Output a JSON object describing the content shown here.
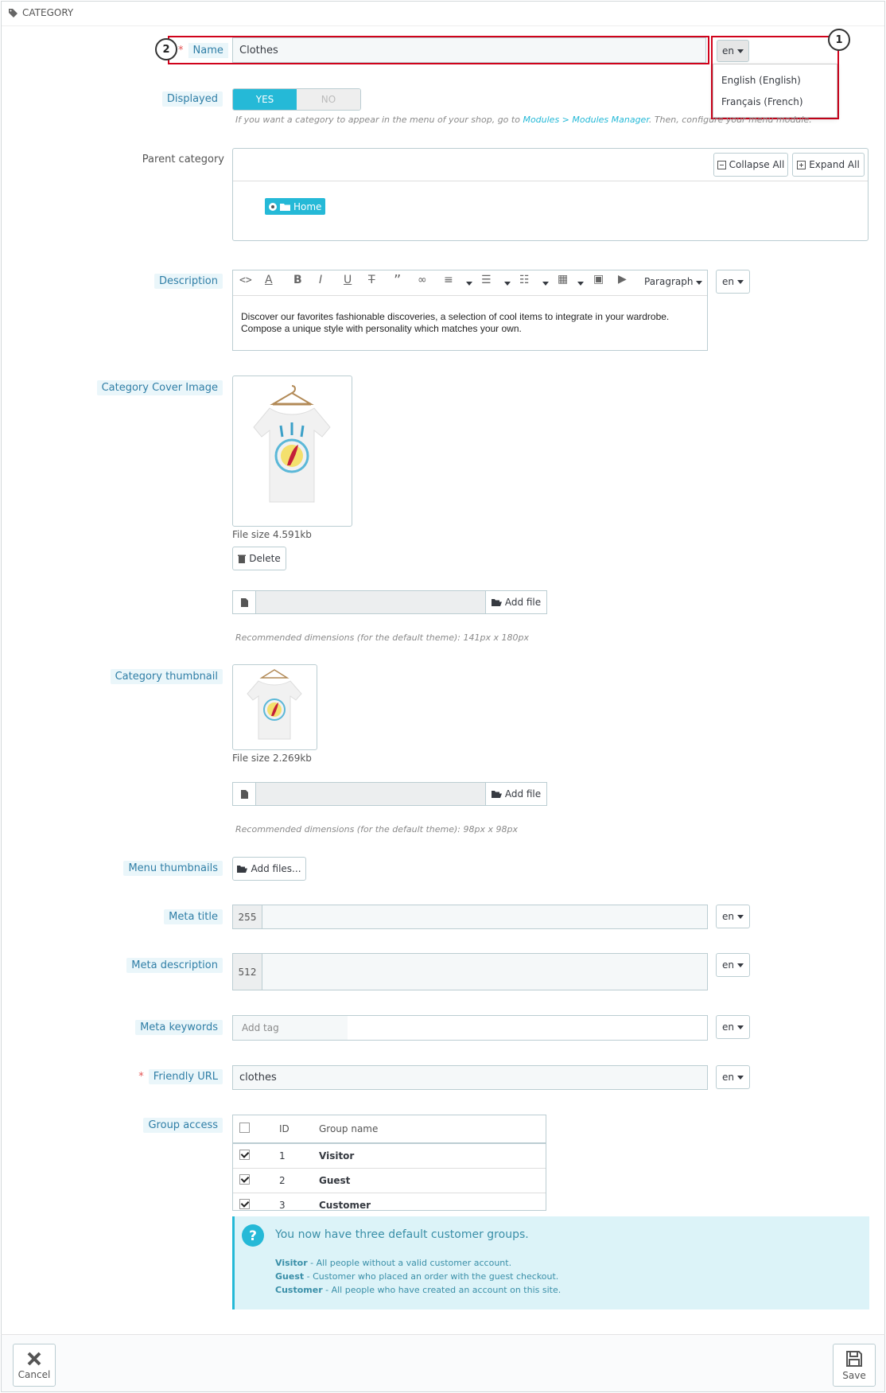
{
  "panel": {
    "heading": "CATEGORY",
    "heading_icon": "tags-icon"
  },
  "annotations": {
    "callout_1": "1",
    "callout_2": "2"
  },
  "name_field": {
    "required_mark": "*",
    "label": "Name",
    "value": "Clothes",
    "lang": "en"
  },
  "lang_dropdown": {
    "options": [
      "English (English)",
      "Français (French)"
    ]
  },
  "displayed": {
    "label": "Displayed",
    "yes": "YES",
    "no": "NO",
    "selected": "YES",
    "help_prefix": "If you want a category to appear in the menu of your shop, go to ",
    "help_link": "Modules > Modules Manager",
    "help_suffix": ". Then, configure your menu module."
  },
  "parent_category": {
    "label": "Parent category",
    "collapse_all": "Collapse All",
    "expand_all": "Expand All",
    "tree_root": "Home"
  },
  "description": {
    "label": "Description",
    "format": "Paragraph",
    "lang": "en",
    "text": "Discover our favorites fashionable discoveries, a selection of cool items to integrate in your wardrobe. Compose a unique style with personality which matches your own."
  },
  "cover_image": {
    "label": "Category Cover Image",
    "file_size": "File size 4.591kb",
    "delete": "Delete",
    "add_file": "Add file",
    "help": "Recommended dimensions (for the default theme): 141px x 180px"
  },
  "thumbnail": {
    "label": "Category thumbnail",
    "file_size": "File size 2.269kb",
    "add_file": "Add file",
    "help": "Recommended dimensions (for the default theme): 98px x 98px"
  },
  "menu_thumbnails": {
    "label": "Menu thumbnails",
    "add_files": "Add files..."
  },
  "meta_title": {
    "label": "Meta title",
    "counter": "255",
    "value": "",
    "lang": "en"
  },
  "meta_description": {
    "label": "Meta description",
    "counter": "512",
    "value": "",
    "lang": "en"
  },
  "meta_keywords": {
    "label": "Meta keywords",
    "placeholder": "Add tag",
    "lang": "en"
  },
  "friendly_url": {
    "required_mark": "*",
    "label": "Friendly URL",
    "value": "clothes",
    "lang": "en"
  },
  "group_access": {
    "label": "Group access",
    "columns": [
      "ID",
      "Group name"
    ],
    "rows": [
      {
        "id": "1",
        "name": "Visitor",
        "checked": true
      },
      {
        "id": "2",
        "name": "Guest",
        "checked": true
      },
      {
        "id": "3",
        "name": "Customer",
        "checked": true
      }
    ],
    "info_title": "You now have three default customer groups.",
    "info_lines": [
      {
        "term": "Visitor",
        "text": " - All people without a valid customer account."
      },
      {
        "term": "Guest",
        "text": " - Customer who placed an order with the guest checkout."
      },
      {
        "term": "Customer",
        "text": " - All people who have created an account on this site."
      }
    ]
  },
  "footer": {
    "cancel": "Cancel",
    "save": "Save"
  },
  "colors": {
    "accent": "#25b9d7",
    "callout_border": "#d0021b",
    "required": "#e45454"
  }
}
